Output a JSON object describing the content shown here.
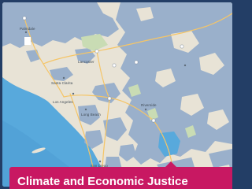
{
  "map": {
    "place_labels": [
      "Palmdale",
      "Lancaster",
      "Santa Clarita",
      "Los Angeles",
      "Long Beach",
      "Riverside",
      "San Diego"
    ],
    "colors": {
      "frame": "#233e66",
      "ocean": "#58a9dc",
      "land": "#e8e3d6",
      "overlay": "#9ab0cb",
      "road": "#f5c567",
      "caption_bg": "#c81862",
      "caption_text": "#ffffff"
    }
  },
  "caption": {
    "text": "Climate and Economic Justice"
  }
}
